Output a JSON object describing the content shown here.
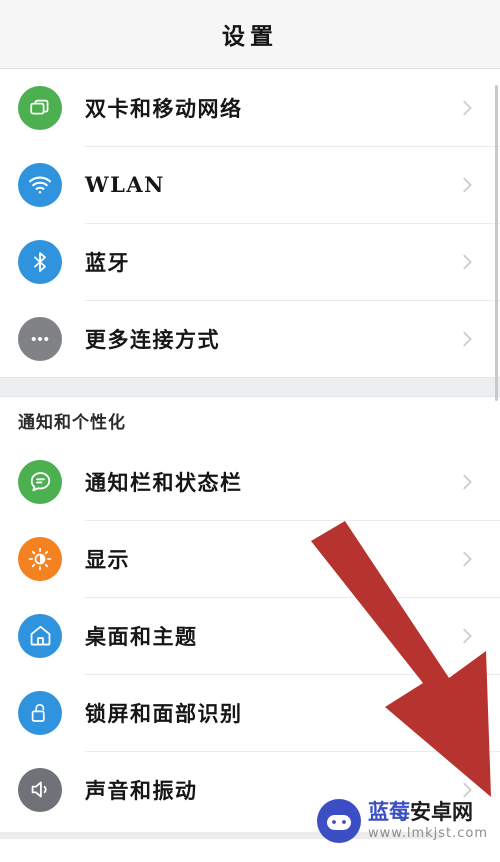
{
  "header": {
    "title": "设置"
  },
  "colors": {
    "header_bg": "#f6f6f6",
    "page_bg": "#ffffff",
    "divider": "#ebebeb",
    "group_gap": "#eceef0",
    "chevron": "#cbcbcb",
    "arrow_red": "#b73330",
    "watermark_blue": "#3b4ec4",
    "icon_green": "#4caf50",
    "icon_blue": "#2f93de",
    "icon_gray": "#808285",
    "icon_orange": "#f58220"
  },
  "groups": [
    {
      "section_label": null,
      "items": [
        {
          "icon": "sim-card-icon",
          "icon_color": "#4caf50",
          "label": "双卡和移动网络",
          "chevron": "chevron-right-icon"
        },
        {
          "icon": "wifi-icon",
          "icon_color": "#2f93de",
          "label": "WLAN",
          "chevron": "chevron-right-icon"
        },
        {
          "icon": "bluetooth-icon",
          "icon_color": "#2f93de",
          "label": "蓝牙",
          "chevron": "chevron-right-icon"
        },
        {
          "icon": "more-dots-icon",
          "icon_color": "#808285",
          "label": "更多连接方式",
          "chevron": "chevron-right-icon"
        }
      ]
    },
    {
      "section_label": "通知和个性化",
      "items": [
        {
          "icon": "notification-bubble-icon",
          "icon_color": "#4caf50",
          "label": "通知栏和状态栏",
          "chevron": "chevron-right-icon"
        },
        {
          "icon": "brightness-icon",
          "icon_color": "#f58220",
          "label": "显示",
          "chevron": "chevron-right-icon"
        },
        {
          "icon": "home-icon",
          "icon_color": "#2f93de",
          "label": "桌面和主题",
          "chevron": "chevron-right-icon"
        },
        {
          "icon": "lock-open-icon",
          "icon_color": "#2f93de",
          "label": "锁屏和面部识别",
          "chevron": "chevron-right-icon"
        },
        {
          "icon": "volume-icon",
          "icon_color": "#6f7276",
          "label": "声音和振动",
          "chevron": "chevron-right-icon"
        }
      ]
    }
  ],
  "annotation": {
    "arrow_name": "red-pointer-arrow",
    "arrow_color": "#b73330"
  },
  "watermark": {
    "brand_part1": "蓝莓",
    "brand_part2": "安卓网",
    "url": "www.lmkjst.com"
  }
}
